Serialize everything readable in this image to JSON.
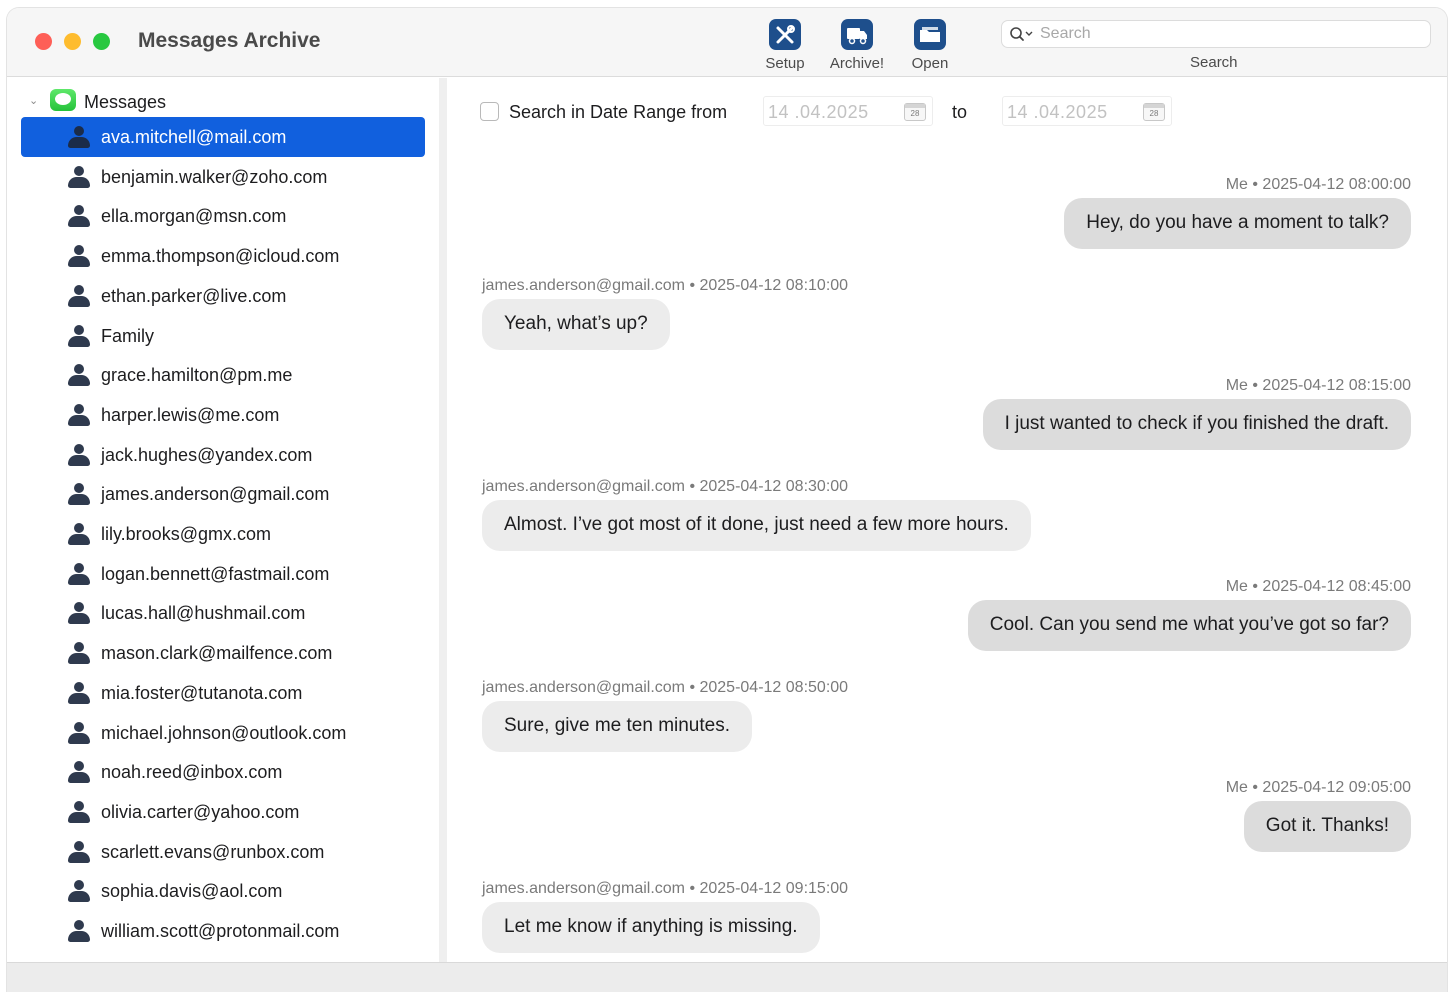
{
  "window": {
    "title": "Messages Archive"
  },
  "toolbar": {
    "setup_label": "Setup",
    "archive_label": "Archive!",
    "open_label": "Open",
    "search_placeholder": "Search",
    "search_caption": "Search"
  },
  "sidebar": {
    "group_label": "Messages",
    "contacts": [
      {
        "label": "ava.mitchell@mail.com",
        "selected": true
      },
      {
        "label": "benjamin.walker@zoho.com"
      },
      {
        "label": "ella.morgan@msn.com"
      },
      {
        "label": "emma.thompson@icloud.com"
      },
      {
        "label": "ethan.parker@live.com"
      },
      {
        "label": "Family"
      },
      {
        "label": "grace.hamilton@pm.me"
      },
      {
        "label": "harper.lewis@me.com"
      },
      {
        "label": "jack.hughes@yandex.com"
      },
      {
        "label": "james.anderson@gmail.com"
      },
      {
        "label": "lily.brooks@gmx.com"
      },
      {
        "label": "logan.bennett@fastmail.com"
      },
      {
        "label": "lucas.hall@hushmail.com"
      },
      {
        "label": "mason.clark@mailfence.com"
      },
      {
        "label": "mia.foster@tutanota.com"
      },
      {
        "label": "michael.johnson@outlook.com"
      },
      {
        "label": "noah.reed@inbox.com"
      },
      {
        "label": "olivia.carter@yahoo.com"
      },
      {
        "label": "scarlett.evans@runbox.com"
      },
      {
        "label": "sophia.davis@aol.com"
      },
      {
        "label": "william.scott@protonmail.com"
      }
    ]
  },
  "filter": {
    "label": "Search in Date Range from",
    "from_date": "14 .04.2025",
    "to_label": "to",
    "to_date": "14 .04.2025",
    "calendar_day": "28"
  },
  "messages": [
    {
      "sender": "me",
      "meta": "Me • 2025-04-12 08:00:00",
      "text": "Hey, do you have a moment to talk?"
    },
    {
      "sender": "them",
      "meta": "james.anderson@gmail.com • 2025-04-12 08:10:00",
      "text": "Yeah, what’s up?"
    },
    {
      "sender": "me",
      "meta": "Me • 2025-04-12 08:15:00",
      "text": "I just wanted to check if you finished the draft."
    },
    {
      "sender": "them",
      "meta": "james.anderson@gmail.com • 2025-04-12 08:30:00",
      "text": "Almost. I’ve got most of it done, just need a few more hours."
    },
    {
      "sender": "me",
      "meta": "Me • 2025-04-12 08:45:00",
      "text": "Cool. Can you send me what you’ve got so far?"
    },
    {
      "sender": "them",
      "meta": "james.anderson@gmail.com • 2025-04-12 08:50:00",
      "text": "Sure, give me ten minutes."
    },
    {
      "sender": "me",
      "meta": "Me • 2025-04-12 09:05:00",
      "text": "Got it. Thanks!"
    },
    {
      "sender": "them",
      "meta": "james.anderson@gmail.com • 2025-04-12 09:15:00",
      "text": "Let me know if anything is missing."
    }
  ],
  "colors": {
    "selection": "#1160de",
    "toolbar_icon": "#1e4f8c",
    "bubble_me": "#dcdcdc",
    "bubble_them": "#ececec"
  },
  "icons": {
    "setup": "tools-icon",
    "archive": "truck-icon",
    "open": "folder-icon",
    "search": "magnifier-icon",
    "group": "messages-app-icon",
    "contact": "person-icon",
    "calendar": "calendar-icon"
  }
}
